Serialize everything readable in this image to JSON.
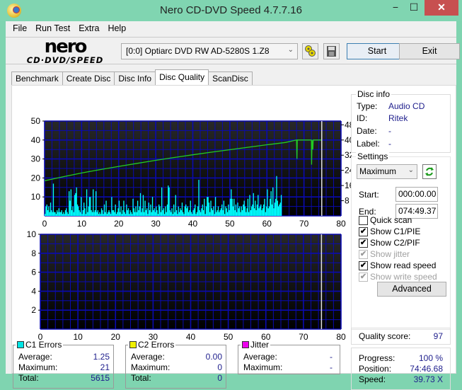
{
  "window": {
    "title": "Nero CD-DVD Speed 4.7.7.16",
    "minimize": "−",
    "maximize": "☐",
    "close": "✕"
  },
  "menu": [
    "File",
    "Run Test",
    "Extra",
    "Help"
  ],
  "logo": {
    "brand": "nero",
    "product": "CD·DVD∕SPEED"
  },
  "toolbar": {
    "drive": "[0:0]  Optiarc DVD RW AD-5280S 1.Z8",
    "drive_arrow": "⌄",
    "start_label": "Start",
    "exit_label": "Exit"
  },
  "tabs": [
    {
      "label": "Benchmark",
      "active": false
    },
    {
      "label": "Create Disc",
      "active": false
    },
    {
      "label": "Disc Info",
      "active": false
    },
    {
      "label": "Disc Quality",
      "active": true
    },
    {
      "label": "ScanDisc",
      "active": false
    }
  ],
  "disc_info": {
    "title": "Disc info",
    "type_label": "Type:",
    "type": "Audio CD",
    "id_label": "ID:",
    "id": "Ritek",
    "date_label": "Date:",
    "date": "-",
    "label_label": "Label:",
    "label": "-"
  },
  "settings": {
    "title": "Settings",
    "speed": "Maximum",
    "start_label": "Start:",
    "start": "000:00.00",
    "end_label": "End:",
    "end": "074:49.37",
    "checks": [
      {
        "label": "Quick scan",
        "checked": false,
        "disabled": false
      },
      {
        "label": "Show C1/PIE",
        "checked": true,
        "disabled": false
      },
      {
        "label": "Show C2/PIF",
        "checked": true,
        "disabled": false
      },
      {
        "label": "Show jitter",
        "checked": true,
        "disabled": true
      },
      {
        "label": "Show read speed",
        "checked": true,
        "disabled": false
      },
      {
        "label": "Show write speed",
        "checked": true,
        "disabled": true
      }
    ],
    "advanced_label": "Advanced"
  },
  "quality": {
    "label": "Quality score:",
    "value": "97"
  },
  "progress": {
    "progress_label": "Progress:",
    "progress": "100 %",
    "position_label": "Position:",
    "position": "74:46.68",
    "speed_label": "Speed:",
    "speed": "39.73 X"
  },
  "c1": {
    "title": "C1 Errors",
    "color": "#00e5e5",
    "avg_label": "Average:",
    "avg": "1.25",
    "max_label": "Maximum:",
    "max": "21",
    "total_label": "Total:",
    "total": "5615"
  },
  "c2": {
    "title": "C2 Errors",
    "color": "#f0f000",
    "avg_label": "Average:",
    "avg": "0.00",
    "max_label": "Maximum:",
    "max": "0",
    "total_label": "Total:",
    "total": "0"
  },
  "jitter": {
    "title": "Jitter",
    "color": "#ee00ee",
    "avg_label": "Average:",
    "avg": "-",
    "max_label": "Maximum:",
    "max": "-"
  },
  "chart_data": [
    {
      "type": "bar",
      "title": "C1 errors and read speed",
      "xlim": [
        0,
        80
      ],
      "ylim": [
        0,
        50
      ],
      "y2lim": [
        0,
        50
      ],
      "xticks": [
        0,
        10,
        20,
        30,
        40,
        50,
        60,
        70,
        80
      ],
      "yticks": [
        10,
        20,
        30,
        40,
        50
      ],
      "y2ticks": [
        8,
        16,
        24,
        32,
        40,
        48
      ],
      "end_marker_x": 74.8,
      "series": [
        {
          "name": "C1 errors",
          "color": "#00ffff",
          "x_step": 0.25,
          "values": [
            1,
            5,
            6,
            3,
            5,
            2,
            7,
            3,
            2,
            17,
            2,
            2,
            1,
            3,
            2,
            4,
            2,
            2,
            3,
            1,
            2,
            1,
            3,
            4,
            2,
            1,
            13,
            8,
            14,
            3,
            5,
            2,
            11,
            12,
            15,
            6,
            5,
            3,
            2,
            10,
            1,
            3,
            7,
            4,
            1,
            14,
            2,
            5,
            10,
            10,
            3,
            2,
            14,
            2,
            3,
            13,
            2,
            3,
            1,
            2,
            1,
            4,
            3,
            1,
            6,
            2,
            8,
            1,
            2,
            3,
            2,
            1,
            10,
            3,
            3,
            2,
            6,
            1,
            2,
            4,
            8,
            2,
            5,
            1,
            3,
            8,
            2,
            1,
            6,
            3,
            4,
            1,
            3,
            2,
            1,
            9,
            4,
            2,
            5,
            2,
            8,
            3,
            5,
            12,
            2,
            4,
            11,
            2,
            8,
            3,
            4,
            1,
            7,
            3,
            6,
            2,
            10,
            3,
            4,
            2,
            5,
            3,
            1,
            6,
            5,
            2,
            15,
            3,
            4,
            1,
            5,
            2,
            6,
            16,
            15,
            3,
            2,
            4,
            1,
            6,
            2,
            11,
            3,
            1,
            5,
            2,
            4,
            3,
            7,
            2,
            1,
            5,
            6,
            4,
            5,
            2,
            3,
            8,
            2,
            1,
            3,
            4,
            6,
            1,
            2,
            5,
            19,
            3,
            2,
            4,
            6,
            3,
            9,
            1,
            5,
            10,
            10,
            7,
            2,
            8,
            4,
            3,
            5,
            1,
            10,
            2,
            3,
            5,
            2,
            3,
            4,
            6,
            3,
            8,
            1,
            5,
            4,
            2,
            6,
            3,
            9,
            14,
            9,
            5,
            9,
            3,
            6,
            2,
            7,
            4,
            5,
            2,
            5,
            3,
            6,
            8,
            5,
            2,
            4,
            9,
            2,
            11,
            3,
            5,
            6,
            12,
            4,
            8,
            3,
            6,
            11,
            4,
            5,
            6,
            3,
            4,
            6,
            9,
            2,
            5,
            14,
            4,
            5,
            9,
            13,
            6,
            15,
            4,
            7,
            9,
            21,
            8,
            5,
            6,
            7,
            11
          ]
        },
        {
          "name": "Read speed",
          "color": "#22cc22",
          "axis": "right",
          "points": [
            [
              0,
              18.5
            ],
            [
              5,
              20.6
            ],
            [
              10,
              22.6
            ],
            [
              15,
              24.4
            ],
            [
              20,
              26.1
            ],
            [
              25,
              27.7
            ],
            [
              30,
              29.3
            ],
            [
              35,
              30.8
            ],
            [
              40,
              32.2
            ],
            [
              45,
              33.6
            ],
            [
              50,
              34.9
            ],
            [
              55,
              36.2
            ],
            [
              60,
              37.5
            ],
            [
              65,
              38.7
            ],
            [
              68,
              40
            ],
            [
              68.1,
              30
            ],
            [
              68.2,
              40
            ],
            [
              72,
              40
            ],
            [
              72.05,
              27
            ],
            [
              72.2,
              40
            ],
            [
              72.4,
              35
            ],
            [
              72.5,
              40
            ],
            [
              74.7,
              40
            ]
          ]
        }
      ]
    },
    {
      "type": "bar",
      "title": "C2 errors",
      "xlim": [
        0,
        80
      ],
      "ylim": [
        0,
        10
      ],
      "xticks": [
        0,
        10,
        20,
        30,
        40,
        50,
        60,
        70,
        80
      ],
      "yticks": [
        2,
        4,
        6,
        8,
        10
      ],
      "end_marker_x": 74.8,
      "series": [
        {
          "name": "C2 errors",
          "color": "#f0f000",
          "values": []
        }
      ]
    }
  ]
}
